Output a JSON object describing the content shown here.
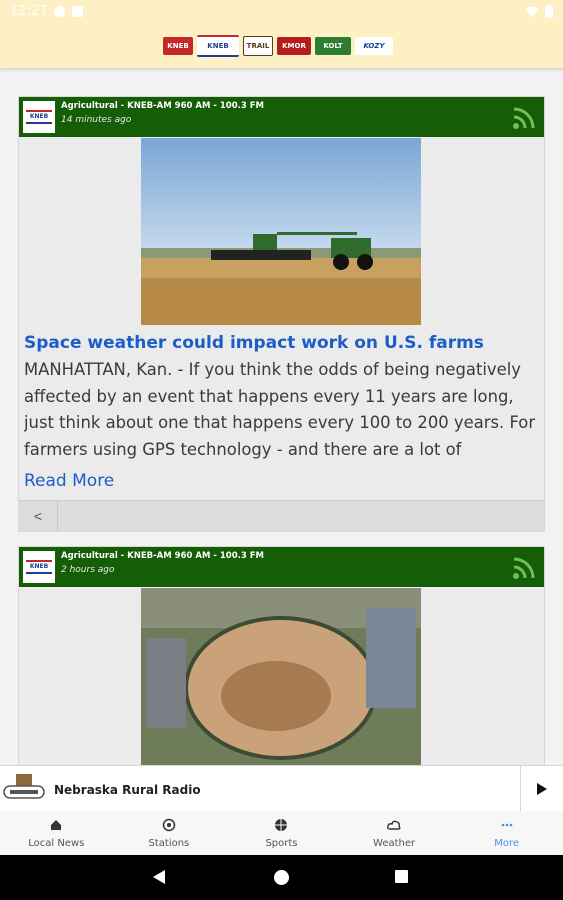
{
  "status_bar": {
    "time": "12:27"
  },
  "header": {
    "logos": [
      {
        "name": "kneb-logo-1",
        "text": "KNEB",
        "color": "#c62828"
      },
      {
        "name": "kneb-logo-2",
        "text": "KNEB",
        "color": "#1e3f8f"
      },
      {
        "name": "trail-logo",
        "text": "TRAIL",
        "color": "#5a3b1c"
      },
      {
        "name": "logo-4",
        "text": "KMOR",
        "color": "#b71c1c"
      },
      {
        "name": "logo-5",
        "text": "KOLT",
        "color": "#2e7d32"
      },
      {
        "name": "logo-6",
        "text": "KOZY",
        "color": "#0d47a1"
      }
    ]
  },
  "feed": {
    "cards": [
      {
        "source": "Agricultural - KNEB-AM 960 AM - 100.3 FM",
        "time": "14 minutes ago",
        "title": "Space weather could impact work on U.S. farms",
        "body": "MANHATTAN, Kan. - If you think the odds of being negatively affected by an event that happens every 11 years are long, just think about one that happens every 100 to 200 years. For farmers using GPS technology - and there are a lot of",
        "read_more": "Read More"
      },
      {
        "source": "Agricultural - KNEB-AM 960 AM - 100.3 FM",
        "time": "2 hours ago"
      }
    ]
  },
  "player": {
    "title": "Nebraska Rural Radio"
  },
  "bottom_nav": {
    "items": [
      {
        "label": "Local News",
        "icon": "home-icon"
      },
      {
        "label": "Stations",
        "icon": "radio-icon"
      },
      {
        "label": "Sports",
        "icon": "ball-icon"
      },
      {
        "label": "Weather",
        "icon": "cloud-icon"
      },
      {
        "label": "More",
        "icon": "more-icon"
      }
    ],
    "active_color": "#4a90e2"
  },
  "colors": {
    "header_bg": "#fdf0c4",
    "card_header_green": "#155e07",
    "link_blue": "#1c5ec9"
  }
}
